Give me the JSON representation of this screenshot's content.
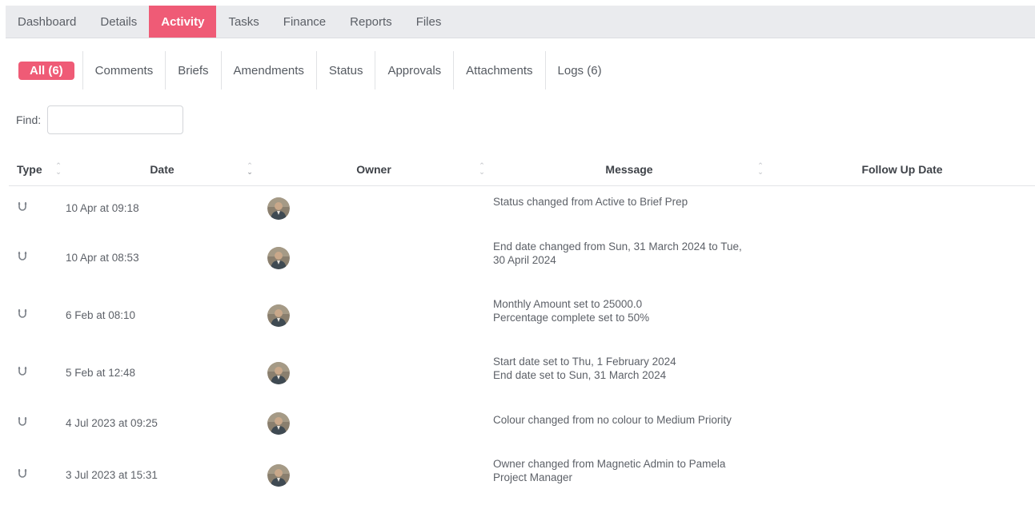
{
  "top_tabs": [
    {
      "label": "Dashboard",
      "active": false
    },
    {
      "label": "Details",
      "active": false
    },
    {
      "label": "Activity",
      "active": true
    },
    {
      "label": "Tasks",
      "active": false
    },
    {
      "label": "Finance",
      "active": false
    },
    {
      "label": "Reports",
      "active": false
    },
    {
      "label": "Files",
      "active": false
    }
  ],
  "sub_tabs": [
    {
      "label": "All (6)",
      "active": true
    },
    {
      "label": "Comments",
      "active": false
    },
    {
      "label": "Briefs",
      "active": false
    },
    {
      "label": "Amendments",
      "active": false
    },
    {
      "label": "Status",
      "active": false
    },
    {
      "label": "Approvals",
      "active": false
    },
    {
      "label": "Attachments",
      "active": false
    },
    {
      "label": "Logs (6)",
      "active": false
    }
  ],
  "find": {
    "label": "Find:",
    "value": "",
    "placeholder": ""
  },
  "table": {
    "headers": {
      "type": "Type",
      "date": "Date",
      "owner": "Owner",
      "message": "Message",
      "follow_up": "Follow Up Date"
    },
    "rows": [
      {
        "type_icon": "magnet-icon",
        "date": "10 Apr at 09:18",
        "message": [
          "Status changed from Active to Brief Prep"
        ],
        "follow_up": ""
      },
      {
        "type_icon": "magnet-icon",
        "date": "10 Apr at 08:53",
        "message": [
          "End date changed from Sun, 31 March 2024 to Tue,",
          "30 April 2024"
        ],
        "follow_up": ""
      },
      {
        "type_icon": "magnet-icon",
        "date": "6 Feb at 08:10",
        "message": [
          "Monthly Amount set to 25000.0",
          "Percentage complete set to 50%"
        ],
        "follow_up": ""
      },
      {
        "type_icon": "magnet-icon",
        "date": "5 Feb at 12:48",
        "message": [
          "Start date set to Thu, 1 February 2024",
          "End date set to Sun, 31 March 2024"
        ],
        "follow_up": ""
      },
      {
        "type_icon": "magnet-icon",
        "date": "4 Jul 2023 at 09:25",
        "message": [
          "Colour changed from no colour to Medium Priority"
        ],
        "follow_up": ""
      },
      {
        "type_icon": "magnet-icon",
        "date": "3 Jul 2023 at 15:31",
        "message": [
          "Owner changed from Magnetic Admin to Pamela",
          "Project Manager"
        ],
        "follow_up": ""
      }
    ]
  },
  "colors": {
    "accent": "#ef5b76",
    "tabbar_bg": "#eaebee"
  }
}
